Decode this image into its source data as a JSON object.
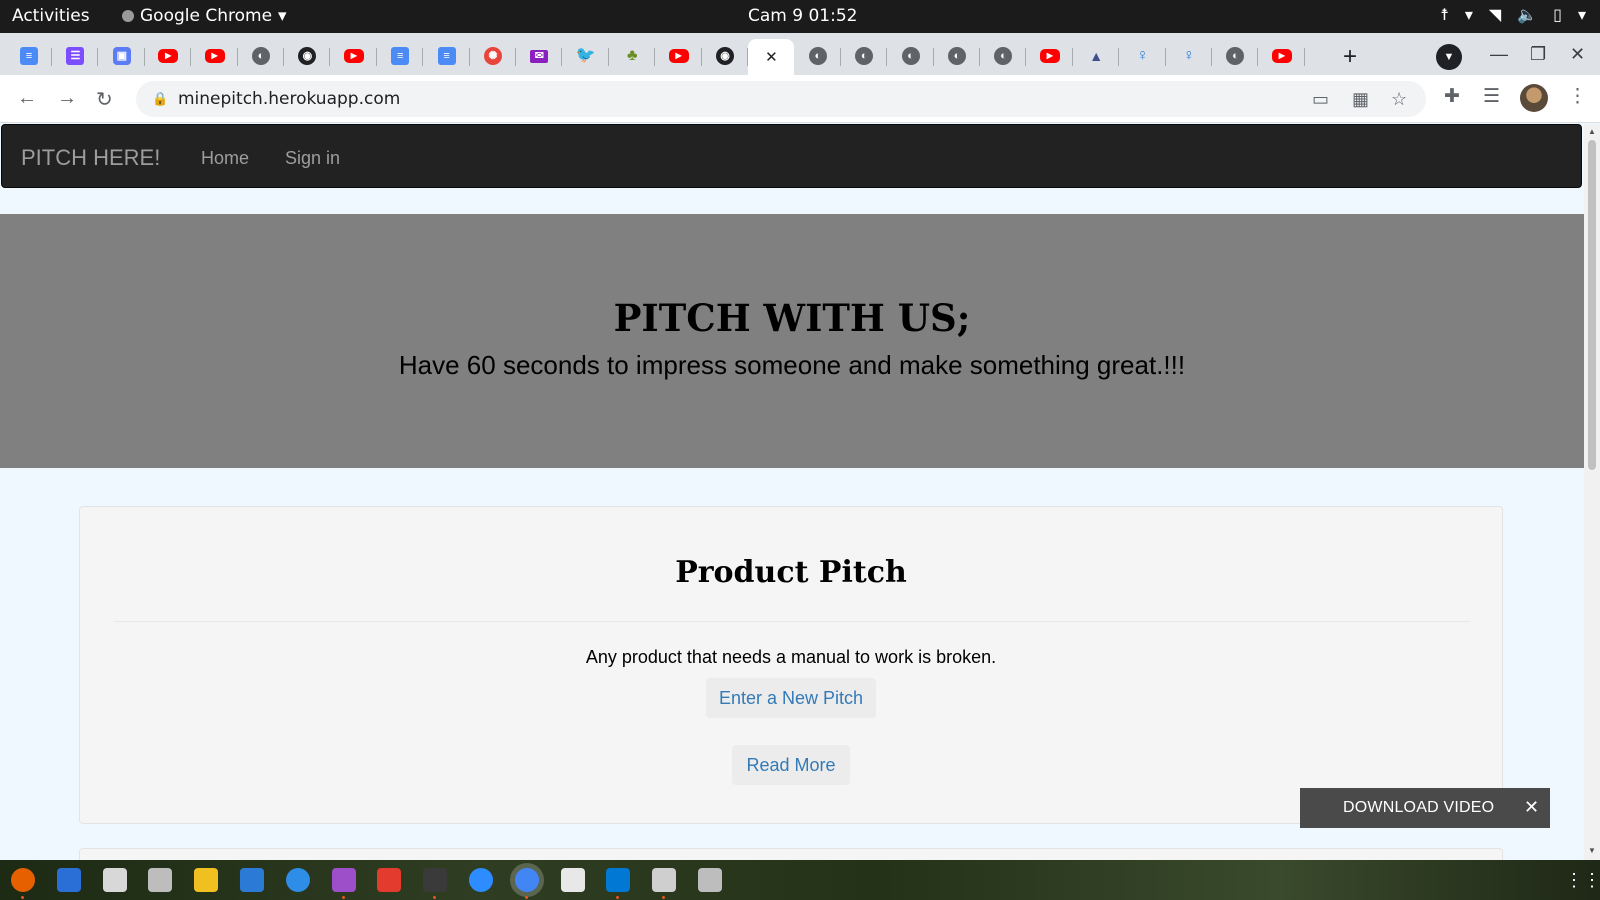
{
  "gnome": {
    "activities": "Activities",
    "app_name": "Google Chrome",
    "clock": "Cam 9  01:52"
  },
  "chrome": {
    "tabs": [
      {
        "icon": "docs-icon",
        "kind": "doc"
      },
      {
        "icon": "forms-icon",
        "kind": "docp"
      },
      {
        "icon": "meet-icon",
        "kind": "meet"
      },
      {
        "icon": "youtube-icon",
        "kind": "yt"
      },
      {
        "icon": "youtube-icon",
        "kind": "yt"
      },
      {
        "icon": "globe-icon",
        "kind": "globe"
      },
      {
        "icon": "github-icon",
        "kind": "gh"
      },
      {
        "icon": "youtube-icon",
        "kind": "yt"
      },
      {
        "icon": "docs-icon",
        "kind": "doc"
      },
      {
        "icon": "docs-icon",
        "kind": "doc"
      },
      {
        "icon": "openai-icon",
        "kind": "ai"
      },
      {
        "icon": "mail-icon",
        "kind": "mail"
      },
      {
        "icon": "twitter-icon",
        "kind": "tw"
      },
      {
        "icon": "tree-icon",
        "kind": "tree"
      },
      {
        "icon": "youtube-icon",
        "kind": "yt"
      },
      {
        "icon": "github-icon",
        "kind": "gh"
      },
      {
        "icon": "close-icon",
        "kind": "active"
      },
      {
        "icon": "globe-icon",
        "kind": "globe"
      },
      {
        "icon": "globe-icon",
        "kind": "globe"
      },
      {
        "icon": "globe-icon",
        "kind": "globe"
      },
      {
        "icon": "globe-icon",
        "kind": "globe"
      },
      {
        "icon": "globe-icon",
        "kind": "globe"
      },
      {
        "icon": "youtube-icon",
        "kind": "yt"
      },
      {
        "icon": "graduation-cap-icon",
        "kind": "cap"
      },
      {
        "icon": "yoga-icon",
        "kind": "yoga"
      },
      {
        "icon": "yoga-icon",
        "kind": "yoga"
      },
      {
        "icon": "globe-icon",
        "kind": "globe"
      },
      {
        "icon": "youtube-icon",
        "kind": "yt"
      }
    ],
    "url": "minepitch.herokuapp.com"
  },
  "site": {
    "brand": "PITCH HERE!",
    "nav": [
      "Home",
      "Sign in"
    ],
    "hero_title": "PITCH WITH US;",
    "hero_subtitle": "Have 60 seconds to impress someone and make something great.!!!",
    "card": {
      "title": "Product Pitch",
      "quote": "Any product that needs a manual to work is broken.",
      "new_pitch": "Enter a New Pitch",
      "read_more": "Read More"
    },
    "download_label": "DOWNLOAD VIDEO"
  },
  "dock": [
    {
      "icon": "firefox-icon",
      "color": "#e66000",
      "dot": true
    },
    {
      "icon": "thunderbird-icon",
      "color": "#2a6fd6",
      "dot": false
    },
    {
      "icon": "files-icon",
      "color": "#d8d8d8",
      "dot": false
    },
    {
      "icon": "screenshot-icon",
      "color": "#bdbdbd",
      "dot": false
    },
    {
      "icon": "rhythmbox-icon",
      "color": "#f0c020",
      "dot": false
    },
    {
      "icon": "writer-icon",
      "color": "#2b7bd6",
      "dot": false
    },
    {
      "icon": "help-icon",
      "color": "#2e8de6",
      "dot": false
    },
    {
      "icon": "video-icon",
      "color": "#9c4fc9",
      "dot": true
    },
    {
      "icon": "anydesk-icon",
      "color": "#e33b2e",
      "dot": false
    },
    {
      "icon": "terminal-icon",
      "color": "#3a3a3a",
      "dot": true
    },
    {
      "icon": "zoom-icon",
      "color": "#2d8cff",
      "dot": false
    },
    {
      "icon": "chrome-icon",
      "color": "#4285f4",
      "dot": true
    },
    {
      "icon": "document-viewer-icon",
      "color": "#e8e8e8",
      "dot": false
    },
    {
      "icon": "vscode-icon",
      "color": "#0078d4",
      "dot": true
    },
    {
      "icon": "usb-creator-icon",
      "color": "#cfcfcf",
      "dot": true
    },
    {
      "icon": "drive-icon",
      "color": "#bdbdbd",
      "dot": false
    }
  ]
}
